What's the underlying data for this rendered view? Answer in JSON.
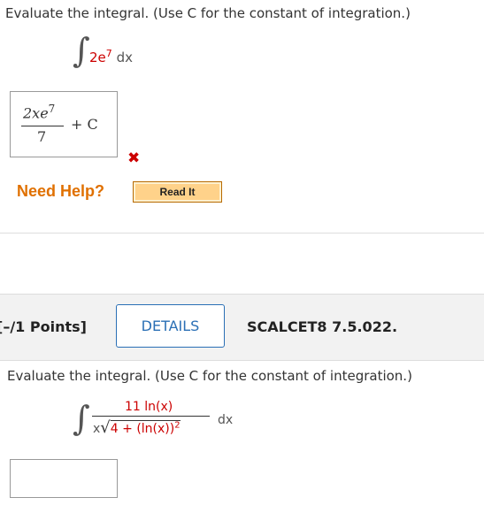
{
  "q1": {
    "prompt": "Evaluate the integral. (Use C for the constant of integration.)",
    "integral_sign": "∫",
    "integrand": "2e",
    "exponent": "7",
    "differential": "dx",
    "answer": {
      "num_base": "2xe",
      "num_exp": "7",
      "den": "7",
      "plus_c": "+ C"
    },
    "mark": "✖"
  },
  "help": {
    "label": "Need Help?",
    "read_it": "Read It"
  },
  "q2_header": {
    "points": "[–/1 Points]",
    "details": "DETAILS",
    "code": "SCALCET8 7.5.022."
  },
  "q2": {
    "prompt": "Evaluate the integral. (Use C for the constant of integration.)",
    "integral_sign": "∫",
    "numerator": "11 ln(x)",
    "x": "x",
    "radical": "√",
    "radicand": "4 + (ln(x))",
    "radicand_exp": "2",
    "differential": "dx"
  },
  "colors": {
    "incorrect": "#cc0000",
    "help": "#e07000",
    "details": "#2a6fb5"
  }
}
